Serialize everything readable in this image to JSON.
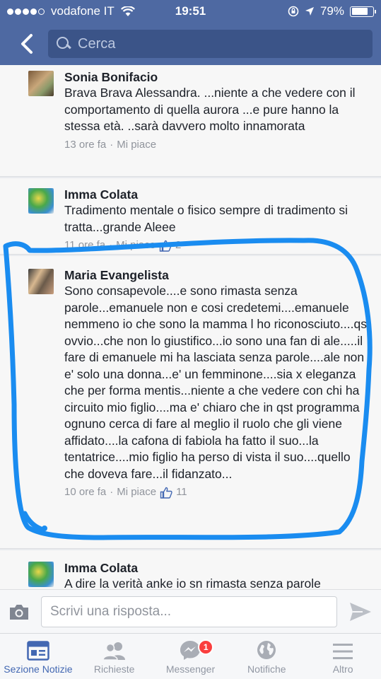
{
  "status": {
    "carrier": "vodafone IT",
    "time": "19:51",
    "battery": "79%",
    "battery_level": 0.79
  },
  "search": {
    "placeholder": "Cerca"
  },
  "comments": [
    {
      "name": "Sonia Bonifacio",
      "text": "Brava  Brava Alessandra. ...niente a che vedere con il comportamento di quella aurora ...e pure hanno la stessa età. ..sarà davvero molto innamorata",
      "time": "13 ore fa",
      "like": "Mi piace",
      "likes": ""
    },
    {
      "name": "Imma Colata",
      "text": "Tradimento  mentale o fisico sempre di tradimento si tratta...grande Aleee",
      "time": "11 ore fa",
      "like": "Mi piace",
      "likes": "2"
    },
    {
      "name": "Maria Evangelista",
      "text": "Sono consapevole....e sono rimasta senza parole...emanuele non e cosi credetemi....emanuele nemmeno io che sono la mamma l ho riconosciuto....qst ovvio...che non lo giustifico...io sono una fan di ale.....il fare di emanuele mi ha lasciata senza parole....ale non e' solo una donna...e' un femminone....sia x eleganza che per forma mentis...niente a che vedere con chi ha circuito mio figlio....ma e' chiaro che in qst programma ognuno cerca di fare al meglio il ruolo che gli viene affidato....la cafona di fabiola ha fatto il suo...la tentatrice....mio figlio ha perso di vista il suo....quello che doveva fare...il fidanzato...",
      "time": "10 ore fa",
      "like": "Mi piace",
      "likes": "11"
    },
    {
      "name": "Imma Colata",
      "text": "A dire la verità anke io sn rimasta senza parole",
      "time": "",
      "like": "",
      "likes": ""
    }
  ],
  "reply": {
    "placeholder": "Scrivi una risposta..."
  },
  "tabs": [
    {
      "label": "Sezione Notizie",
      "icon": "news-feed-icon",
      "active": true
    },
    {
      "label": "Richieste",
      "icon": "friend-requests-icon"
    },
    {
      "label": "Messenger",
      "icon": "messenger-icon",
      "badge": "1"
    },
    {
      "label": "Notifiche",
      "icon": "globe-icon"
    },
    {
      "label": "Altro",
      "icon": "menu-icon"
    }
  ],
  "colors": {
    "header": "#4e69a2",
    "accent": "#4267b2",
    "scribble": "#1a8cf0",
    "badge": "#fa3e3e"
  }
}
